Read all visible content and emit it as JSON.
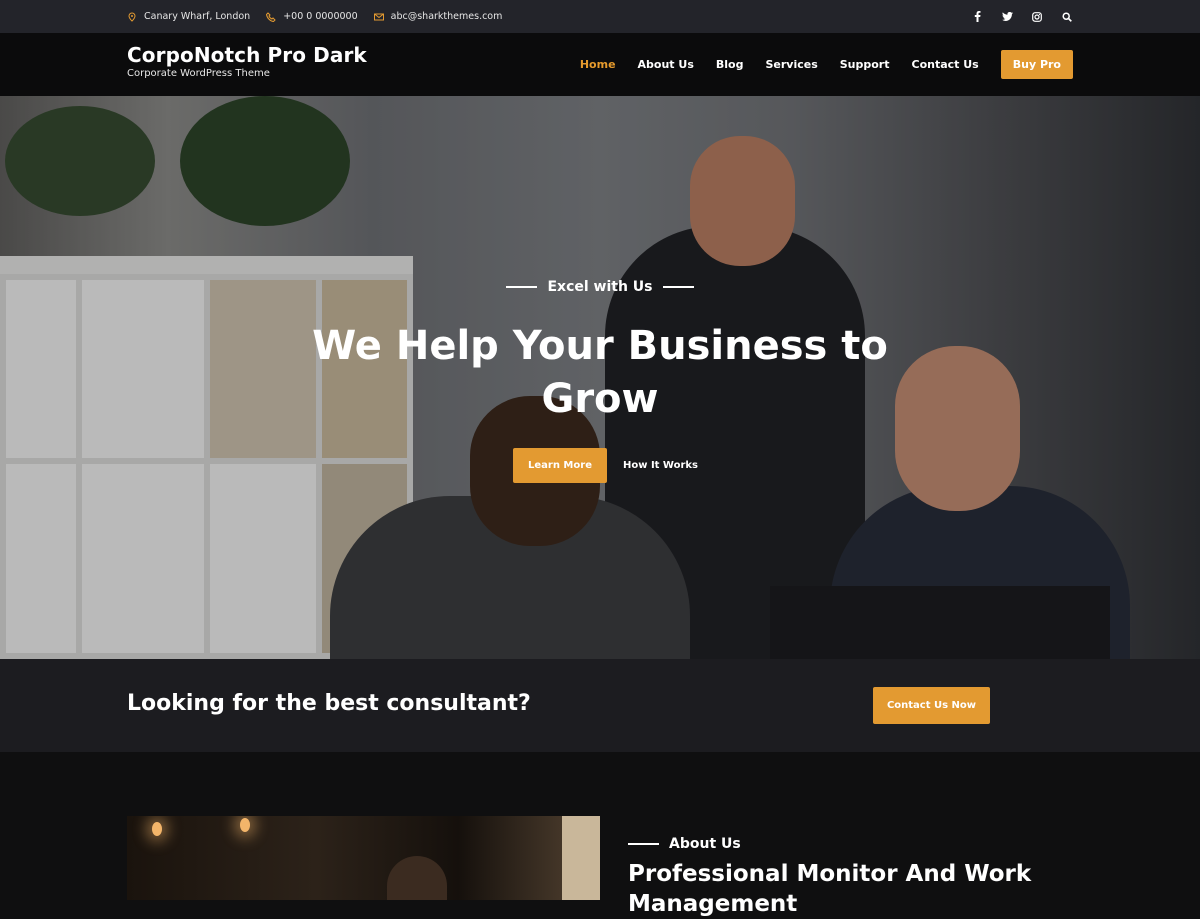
{
  "topbar": {
    "location": "Canary Wharf, London",
    "phone": "+00 0 0000000",
    "email": "abc@sharkthemes.com",
    "social_icons": [
      "facebook-icon",
      "twitter-icon",
      "instagram-icon",
      "search-icon"
    ]
  },
  "header": {
    "site_title": "CorpoNotch Pro Dark",
    "tagline": "Corporate WordPress Theme",
    "nav": [
      {
        "label": "Home",
        "active": true
      },
      {
        "label": "About Us",
        "active": false
      },
      {
        "label": "Blog",
        "active": false
      },
      {
        "label": "Services",
        "active": false
      },
      {
        "label": "Support",
        "active": false
      },
      {
        "label": "Contact Us",
        "active": false
      }
    ],
    "buy_label": "Buy Pro"
  },
  "hero": {
    "eyebrow": "Excel with Us",
    "headline_line1": "We Help Your Business to",
    "headline_line2": "Grow",
    "primary_label": "Learn More",
    "secondary_label": "How It Works"
  },
  "cta": {
    "question": "Looking for the best consultant?",
    "button_label": "Contact Us Now"
  },
  "about": {
    "label": "About Us",
    "heading_line1": "Professional Monitor And Work",
    "heading_line2": "Management"
  },
  "colors": {
    "accent": "#e39a31",
    "topbar_bg": "#23242a",
    "header_bg": "#0b0b0c",
    "cta_bg": "#1c1c20",
    "page_bg": "#0f0f10"
  }
}
